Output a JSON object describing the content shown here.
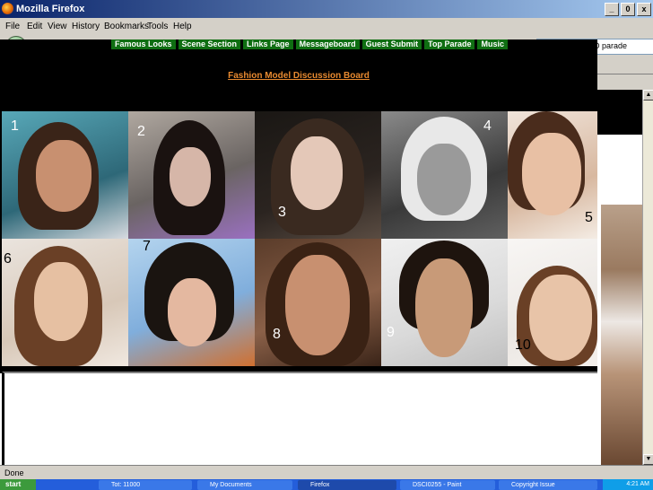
{
  "window": {
    "title": "Mozilla Firefox",
    "buttons": [
      "_",
      "0",
      "x"
    ]
  },
  "menu": [
    "File",
    "Edit",
    "View",
    "History",
    "Bookmarks",
    "Tools",
    "Help"
  ],
  "toolbar": {
    "url_fragment": "D parade"
  },
  "navlinks": [
    "Famous Looks",
    "Scene Section",
    "Links Page",
    "Messageboard",
    "Guest Submit",
    "Top Parade",
    "Music"
  ],
  "board_link": "Fashion Model Discussion Board",
  "grid": {
    "numbers": [
      "1",
      "2",
      "3",
      "4",
      "5",
      "6",
      "7",
      "8",
      "9",
      "10"
    ]
  },
  "status": {
    "text": "Done"
  },
  "taskbar": {
    "start": "start",
    "tasks": [
      "Tot: 11000",
      "My Documents",
      "Firefox",
      "DSCI0255 - Paint",
      "Copyright Issue"
    ],
    "tray_time": "4:21 AM"
  }
}
